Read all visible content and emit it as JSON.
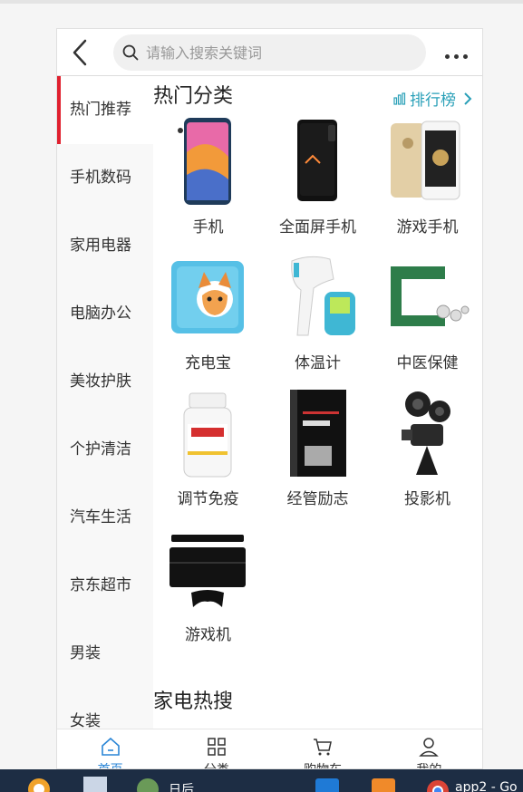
{
  "header": {
    "search_placeholder": "请输入搜索关键词"
  },
  "sidebar": {
    "items": [
      "热门推荐",
      "手机数码",
      "家用电器",
      "电脑办公",
      "美妆护肤",
      "个护清洁",
      "汽车生活",
      "京东超市",
      "男装",
      "女装"
    ],
    "active_index": 0
  },
  "hot": {
    "title": "热门分类",
    "rank_label": "排行榜",
    "items": [
      {
        "label": "手机",
        "icon": "phone-product-image"
      },
      {
        "label": "全面屏手机",
        "icon": "fullscreen-phone-image"
      },
      {
        "label": "游戏手机",
        "icon": "gaming-phone-image"
      },
      {
        "label": "充电宝",
        "icon": "power-bank-image"
      },
      {
        "label": "体温计",
        "icon": "thermometer-image"
      },
      {
        "label": "中医保健",
        "icon": "tcm-health-image"
      },
      {
        "label": "调节免疫",
        "icon": "supplement-bottle-image"
      },
      {
        "label": "经管励志",
        "icon": "principles-book-image"
      },
      {
        "label": "投影机",
        "icon": "projector-image"
      },
      {
        "label": "游戏机",
        "icon": "game-console-image"
      }
    ]
  },
  "appliance": {
    "title": "家电热搜"
  },
  "bottom_nav": {
    "items": [
      "首页",
      "分类",
      "购物车",
      "我的"
    ],
    "active_index": 0,
    "active_color": "#2b86d6"
  },
  "taskbar": {
    "user_label": "日后",
    "chrome_label": "app2 - Go"
  },
  "colors": {
    "accent_red": "#e0212f",
    "link_teal": "#2aa0b8"
  }
}
